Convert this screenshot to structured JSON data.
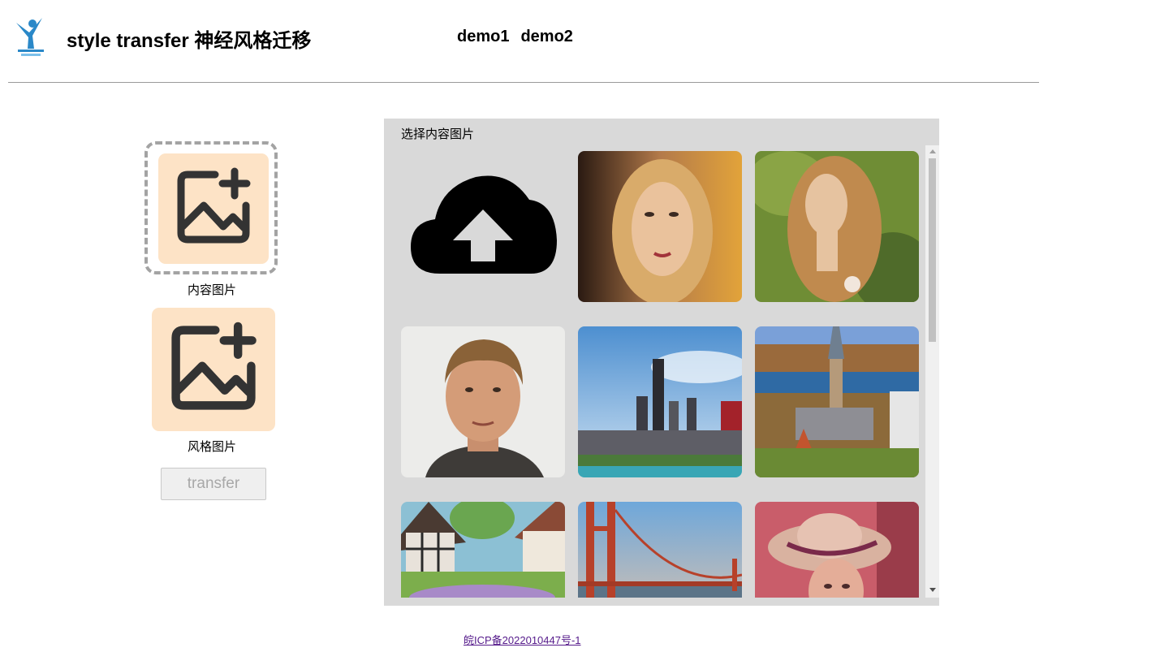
{
  "header": {
    "title": "style transfer 神经风格迁移",
    "nav": [
      "demo1",
      "demo2"
    ]
  },
  "left": {
    "content_label": "内容图片",
    "style_label": "风格图片",
    "transfer_label": "transfer"
  },
  "panel": {
    "title": "选择内容图片",
    "items": [
      {
        "icon": "cloud-upload-icon"
      },
      {
        "name": "portrait-blonde-woman"
      },
      {
        "name": "portrait-woman-forest"
      },
      {
        "name": "portrait-man"
      },
      {
        "name": "city-skyline"
      },
      {
        "name": "clock-tower-campus"
      },
      {
        "name": "half-timbered-houses"
      },
      {
        "name": "golden-gate-bridge"
      },
      {
        "name": "woman-with-hat"
      }
    ]
  },
  "footer": {
    "icp": "皖ICP备2022010447号-1"
  },
  "colors": {
    "slot_bg": "#fde3c6",
    "panel_bg": "#d9d9d9",
    "link": "#551a8b"
  }
}
